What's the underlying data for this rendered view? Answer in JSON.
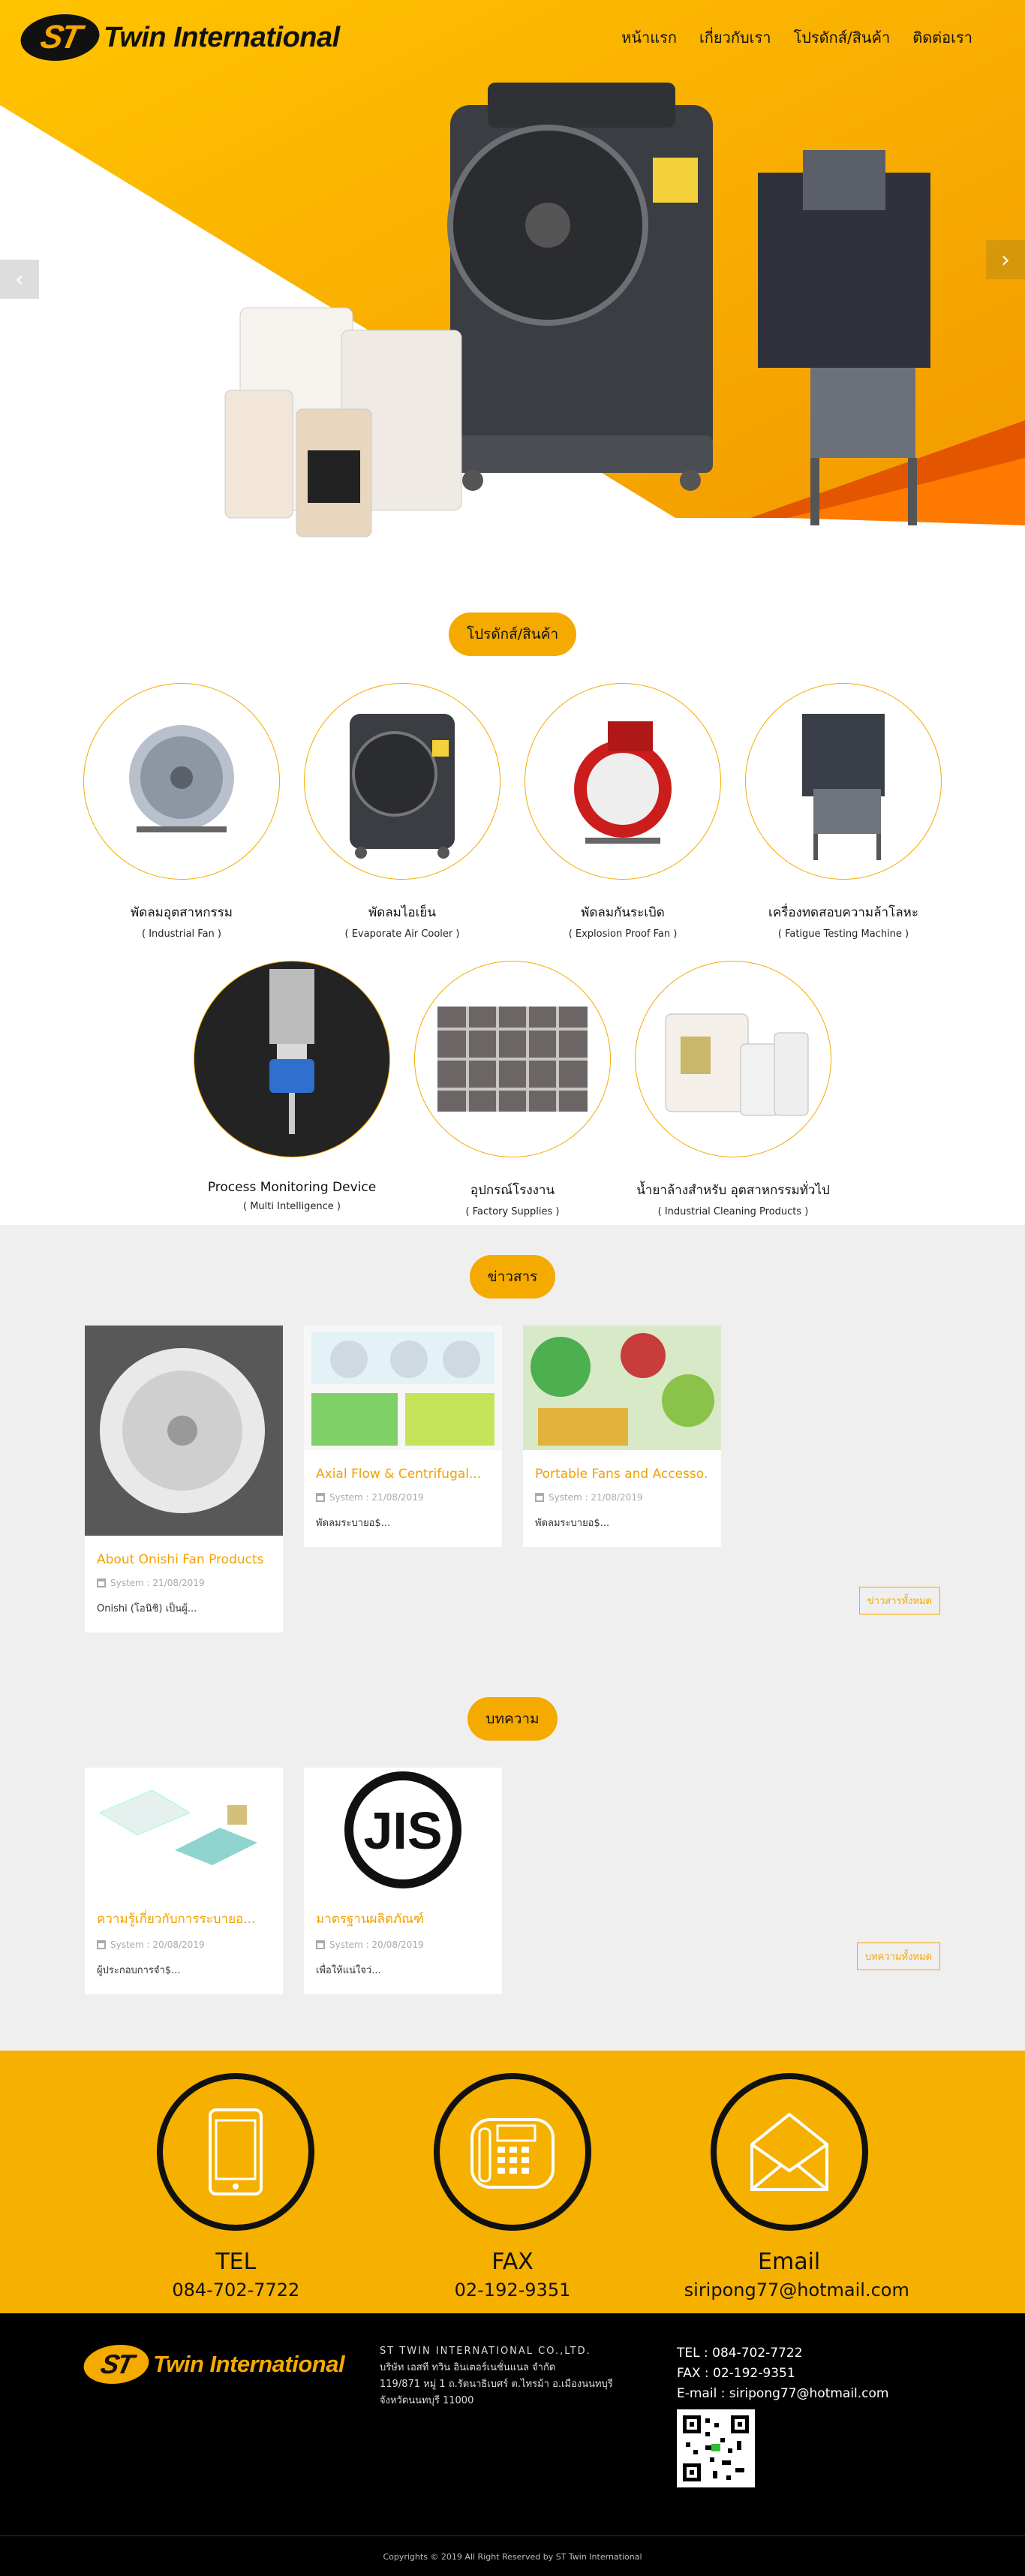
{
  "brand": {
    "badge": "ST",
    "name": "Twin International"
  },
  "nav": {
    "items": [
      {
        "label": "หน้าแรก"
      },
      {
        "label": "เกี่ยวกับเรา"
      },
      {
        "label": "โปรดักส์/สินค้า"
      },
      {
        "label": "ติดต่อเรา"
      }
    ]
  },
  "slider": {
    "prev_icon": "chevron-left-icon",
    "next_icon": "chevron-right-icon",
    "slides": 3,
    "active_slide": 3
  },
  "products": {
    "heading": "โปรดักส์/สินค้า",
    "items": [
      {
        "name": "พัดลมอุตสาหกรรม",
        "sub": "( Industrial Fan )"
      },
      {
        "name": "พัดลมไอเย็น",
        "sub": "( Evaporate Air Cooler )"
      },
      {
        "name": "พัดลมกันระเบิด",
        "sub": "( Explosion Proof Fan )"
      },
      {
        "name": "เครื่องทดสอบความล้าโลหะ",
        "sub": "( Fatigue Testing Machine )"
      },
      {
        "name": "Process Monitoring Device",
        "sub": "( Multi Intelligence )"
      },
      {
        "name": "อุปกรณ์โรงงาน",
        "sub": "( Factory Supplies )"
      },
      {
        "name": "น้ำยาล้างสำหรับ อุตสาหกรรมทั่วไป",
        "sub": "( Industrial Cleaning Products )"
      }
    ]
  },
  "news": {
    "heading": "ข่าวสาร",
    "more": "ข่าวสารทั้งหมด",
    "cards": [
      {
        "title": "About Onishi Fan Products",
        "meta": "System : 21/08/2019",
        "text": "Onishi (โอนิชิ) เป็นผู้..."
      },
      {
        "title": "Axial Flow & Centrifugal...",
        "meta": "System : 21/08/2019",
        "text": "พัดลมระบายอ$..."
      },
      {
        "title": "Portable Fans and Accesso...",
        "meta": "System : 21/08/2019",
        "text": "พัดลมระบายอ$..."
      }
    ]
  },
  "articles": {
    "heading": "บทความ",
    "more": "บทความทั้งหมด",
    "cards": [
      {
        "title": "ความรู้เกี่ยวกับการระบายอ...",
        "meta": "System : 20/08/2019",
        "text": "ผู้ประกอบการจำ$..."
      },
      {
        "title": "มาตรฐานผลิตภัณฑ์",
        "meta": "System : 20/08/2019",
        "text": "เพื่อให้แน่ใจว่..."
      }
    ],
    "logo_text": "JIS"
  },
  "contact": {
    "items": [
      {
        "label": "TEL",
        "value": "084-702-7722",
        "icon": "phone-icon"
      },
      {
        "label": "FAX",
        "value": "02-192-9351",
        "icon": "fax-icon"
      },
      {
        "label": "Email",
        "value": "siripong77@hotmail.com",
        "icon": "mail-icon"
      }
    ]
  },
  "footer": {
    "company_name": "ST TWIN INTERNATIONAL CO.,LTD.",
    "company_thai": "บริษัท เอสที ทวิน อินเตอร์เนชั่นแนล จำกัด",
    "address": "119/871 หมู่ 1 ถ.รัตนาธิเบศร์ ต.ไทรม้า อ.เมืองนนทบุรี จังหวัดนนทบุรี 11000",
    "tel": "TEL : 084-702-7722",
    "fax": "FAX : 02-192-9351",
    "email": "E-mail : siripong77@hotmail.com",
    "copyright": "Copyrights © 2019 All Right Reserved by ST Twin International"
  },
  "colors": {
    "accent": "#f5aa00",
    "footer_bg": "#000000",
    "grey_bg": "#efefef"
  }
}
